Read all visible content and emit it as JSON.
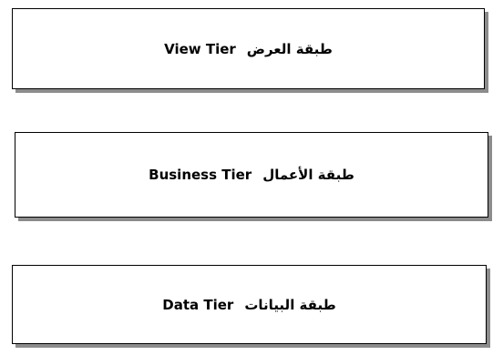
{
  "tiers": [
    {
      "english": "View Tier",
      "arabic": "طبقة العرض"
    },
    {
      "english": "Business Tier",
      "arabic": "طبقة الأعمال"
    },
    {
      "english": "Data Tier",
      "arabic": "طبقة البيانات"
    }
  ]
}
